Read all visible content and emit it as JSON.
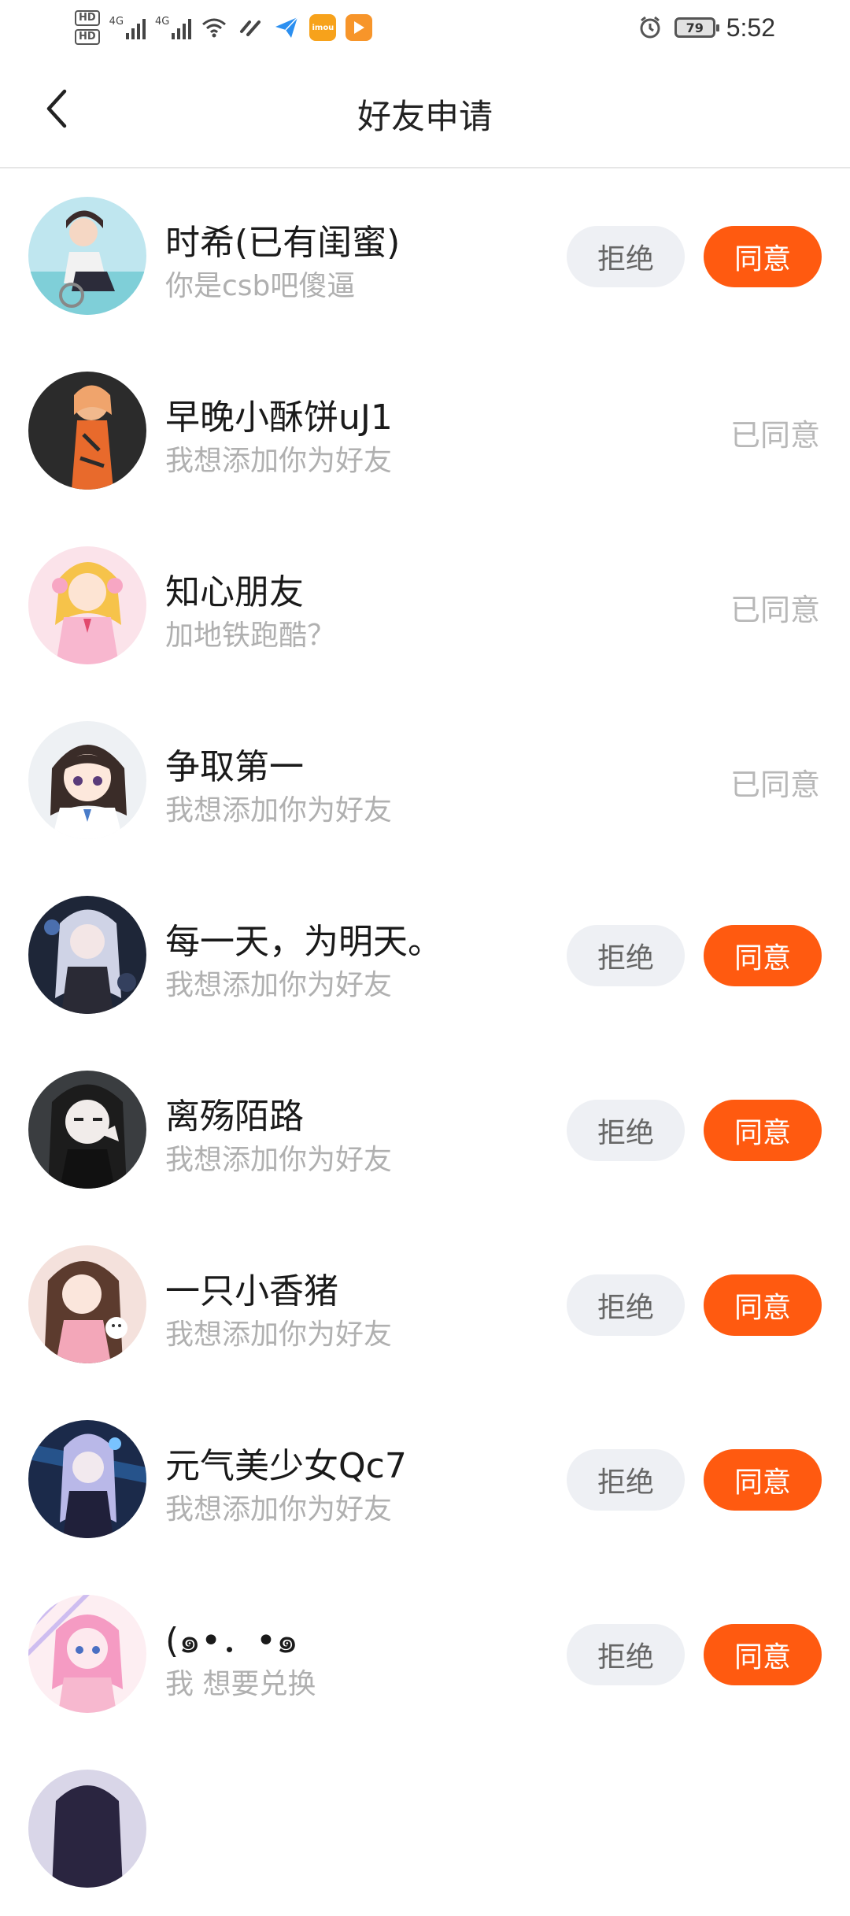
{
  "status_bar": {
    "hd1": "HD",
    "hd2": "HD",
    "net1": "4G",
    "net2": "4G",
    "imou_label": "imou",
    "battery": "79",
    "time": "5:52"
  },
  "header": {
    "title": "好友申请"
  },
  "buttons": {
    "reject": "拒绝",
    "accept": "同意"
  },
  "requests": [
    {
      "name": "时希(已有闺蜜)",
      "message": "你是csb吧傻逼",
      "status": "pending",
      "status_text": ""
    },
    {
      "name": "早晚小酥饼uJ1",
      "message": "我想添加你为好友",
      "status": "accepted",
      "status_text": "已同意"
    },
    {
      "name": "知心朋友",
      "message": "加地铁跑酷？",
      "status": "accepted",
      "status_text": "已同意"
    },
    {
      "name": "争取第一",
      "message": "我想添加你为好友",
      "status": "accepted",
      "status_text": "已同意"
    },
    {
      "name": "每一天，为明天。",
      "message": "我想添加你为好友",
      "status": "pending",
      "status_text": ""
    },
    {
      "name": "离殇陌路",
      "message": "我想添加你为好友",
      "status": "pending",
      "status_text": ""
    },
    {
      "name": "一只小香猪",
      "message": "我想添加你为好友",
      "status": "pending",
      "status_text": ""
    },
    {
      "name": "元气美少女Qc7",
      "message": "我想添加你为好友",
      "status": "pending",
      "status_text": ""
    },
    {
      "name": "(๑•．•๑",
      "message": "我 想要兑换",
      "status": "pending",
      "status_text": ""
    }
  ],
  "colors": {
    "accent": "#ff5a10",
    "reject_bg": "#eef0f4",
    "muted_text": "#b0b0b0"
  }
}
